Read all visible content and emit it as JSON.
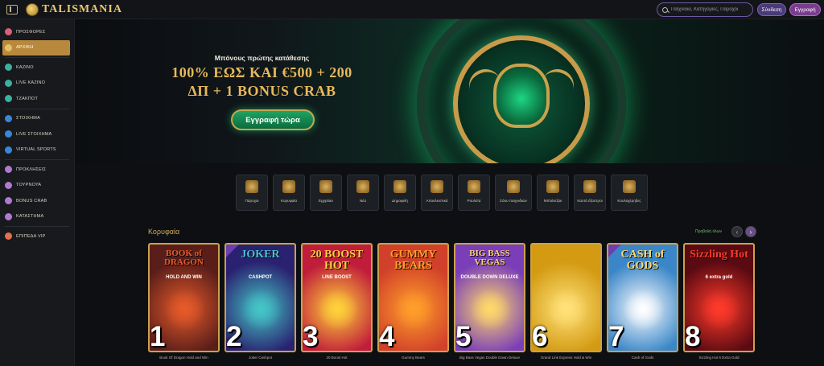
{
  "header": {
    "logo_text": "TALISMANIA",
    "search_placeholder": "Παιχνίδια, Κατηγορίες, Πάροχοι",
    "login_label": "Σύνδεση",
    "register_label": "Εγγραφή"
  },
  "sidebar": {
    "items": [
      {
        "label": "ΠΡΟΣΦΟΡΕΣ",
        "icon": "gift-icon",
        "color": "#d9607a"
      },
      {
        "label": "ΑΡΧΙΚΗ",
        "icon": "home-icon",
        "color": "#e5c06a"
      },
      {
        "label": "ΚΑΖΙΝΟ",
        "icon": "casino-icon",
        "color": "#3bb0a0"
      },
      {
        "label": "LIVE ΚΑΖΙΝΟ",
        "icon": "live-casino-icon",
        "color": "#3bb0a0"
      },
      {
        "label": "ΤΖΑΚΠΟΤ",
        "icon": "jackpot-icon",
        "color": "#3bb0a0"
      },
      {
        "label": "ΣΤΟΙΧΗΜΑ",
        "icon": "sports-icon",
        "color": "#3a86d6"
      },
      {
        "label": "LIVE ΣΤΟΙΧΗΜΑ",
        "icon": "live-sports-icon",
        "color": "#3a86d6"
      },
      {
        "label": "VIRTUAL SPORTS",
        "icon": "virtual-sports-icon",
        "color": "#3a86d6"
      },
      {
        "label": "ΠΡΟΚΛΗΣΕΙΣ",
        "icon": "challenges-icon",
        "color": "#b07ad0"
      },
      {
        "label": "ΤΟΥΡΝΟΥΑ",
        "icon": "tournaments-icon",
        "color": "#b07ad0"
      },
      {
        "label": "BONUS CRAB",
        "icon": "crab-icon",
        "color": "#b07ad0"
      },
      {
        "label": "ΚΑΤΑΣΤΗΜΑ",
        "icon": "shop-icon",
        "color": "#b07ad0"
      },
      {
        "label": "ΕΠΙΠΕΔΑ VIP",
        "icon": "vip-icon",
        "color": "#e2704a"
      }
    ]
  },
  "hero": {
    "subtitle": "Μπόνους πρώτης κατάθεσης",
    "title_line1": "100% ΕΩΣ ΚΑΙ €500 + 200",
    "title_line2": "ΔΠ + 1 BONUS CRAB",
    "cta_label": "Εγγραφή τώρα"
  },
  "categories": [
    {
      "label": "Πάροχοι",
      "icon": "providers-icon"
    },
    {
      "label": "Κορυφαία",
      "icon": "top-icon"
    },
    {
      "label": "Egyptian",
      "icon": "egyptian-icon"
    },
    {
      "label": "Νέα",
      "icon": "new-icon"
    },
    {
      "label": "Δημοφιλή",
      "icon": "popular-icon"
    },
    {
      "label": "Αποκλειστικά",
      "icon": "exclusive-icon"
    },
    {
      "label": "Ρουλέτα",
      "icon": "roulette-icon"
    },
    {
      "label": "Σόου παιχνιδιών",
      "icon": "game-show-icon"
    },
    {
      "label": "Μπλάκτζακ",
      "icon": "blackjack-icon"
    },
    {
      "label": "Καυτά έξαστροι",
      "icon": "hot-icon"
    },
    {
      "label": "Κουλοχέρηδες",
      "icon": "slots-icon"
    }
  ],
  "section": {
    "title": "Κορυφαία",
    "view_all": "Προβολή όλων",
    "prev": "‹",
    "next": "›"
  },
  "games": [
    {
      "rank": "1",
      "name": "Book Of Dragon Hold and Win",
      "art_title": "BOOK of DRAGON",
      "art_sub": "HOLD AND WIN",
      "bg": "#5a1e1a",
      "accent": "#e65a2a"
    },
    {
      "rank": "2",
      "name": "Joker Cashpot",
      "art_title": "JOKER",
      "art_sub": "CASHPOT",
      "bg": "#2a2170",
      "accent": "#44c6c6"
    },
    {
      "rank": "3",
      "name": "20 Boost Hot",
      "art_title": "20 BOOST HOT",
      "art_sub": "LINE BOOST",
      "bg": "#c01d3a",
      "accent": "#ffd23a"
    },
    {
      "rank": "4",
      "name": "Gummy Bears",
      "art_title": "GUMMY BEARS",
      "art_sub": "",
      "bg": "#d1402a",
      "accent": "#ff9f2a"
    },
    {
      "rank": "5",
      "name": "Big Bass Vegas Double Down Deluxe",
      "art_title": "BIG BASS VEGAS",
      "art_sub": "DOUBLE DOWN DELUXE",
      "bg": "#7a3fb8",
      "accent": "#ffd86a"
    },
    {
      "rank": "6",
      "name": "Grand Link Express Hold & Win",
      "art_title": "",
      "art_sub": "",
      "bg": "#d39a12",
      "accent": "#ffe27a"
    },
    {
      "rank": "7",
      "name": "Cash of Gods",
      "art_title": "CASH of GODS",
      "art_sub": "",
      "bg": "#3a86c8",
      "accent": "#ffffff"
    },
    {
      "rank": "8",
      "name": "Sizzling Hot 6 Extra Gold",
      "art_title": "Sizzling Hot",
      "art_sub": "6 extra gold",
      "bg": "#5a0a12",
      "accent": "#ff3a2a"
    }
  ]
}
